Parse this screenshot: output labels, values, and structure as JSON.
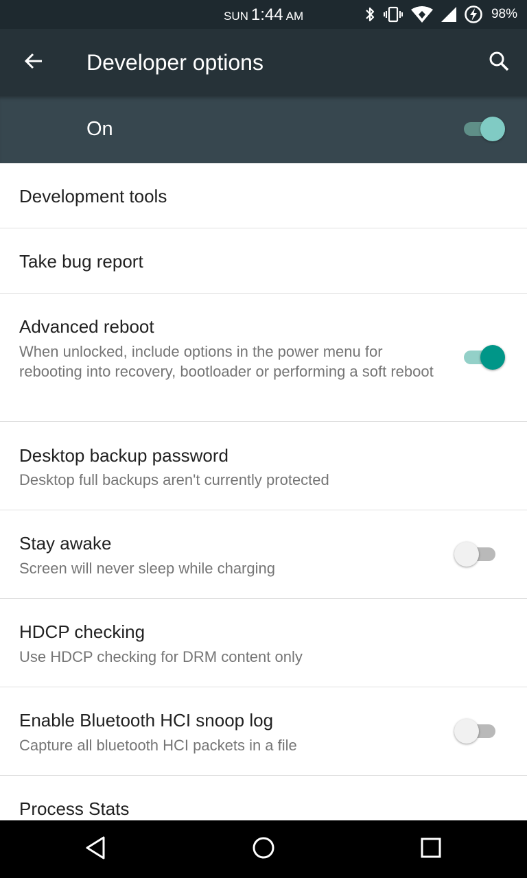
{
  "status_bar": {
    "day": "SUN",
    "time": "1:44",
    "ampm": "AM",
    "battery": "98%",
    "icons": [
      "bluetooth-icon",
      "vibrate-icon",
      "wifi-icon",
      "cell-signal-icon",
      "battery-charging-icon"
    ]
  },
  "app_bar": {
    "title": "Developer options",
    "back_icon": "arrow-back-icon",
    "search_icon": "search-icon"
  },
  "master_switch": {
    "label": "On",
    "state": "on",
    "accent": "#80cbc4"
  },
  "items": [
    {
      "title": "Development tools"
    },
    {
      "title": "Take bug report"
    },
    {
      "title": "Advanced reboot",
      "summary": "When unlocked, include options in the power menu for rebooting into recovery, bootloader or performing a soft reboot",
      "toggle": "on"
    },
    {
      "title": "Desktop backup password",
      "summary": "Desktop full backups aren't currently protected"
    },
    {
      "title": "Stay awake",
      "summary": "Screen will never sleep while charging",
      "toggle": "off"
    },
    {
      "title": "HDCP checking",
      "summary": "Use HDCP checking for DRM content only"
    },
    {
      "title": "Enable Bluetooth HCI snoop log",
      "summary": "Capture all bluetooth HCI packets in a file",
      "toggle": "off"
    },
    {
      "title": "Process Stats"
    }
  ],
  "nav_bar": {
    "icons": [
      "back-triangle-icon",
      "home-circle-icon",
      "recents-square-icon"
    ]
  },
  "colors": {
    "status_bar": "#1e292f",
    "app_bar": "#263238",
    "master_bar": "#37474f",
    "accent": "#009688"
  }
}
